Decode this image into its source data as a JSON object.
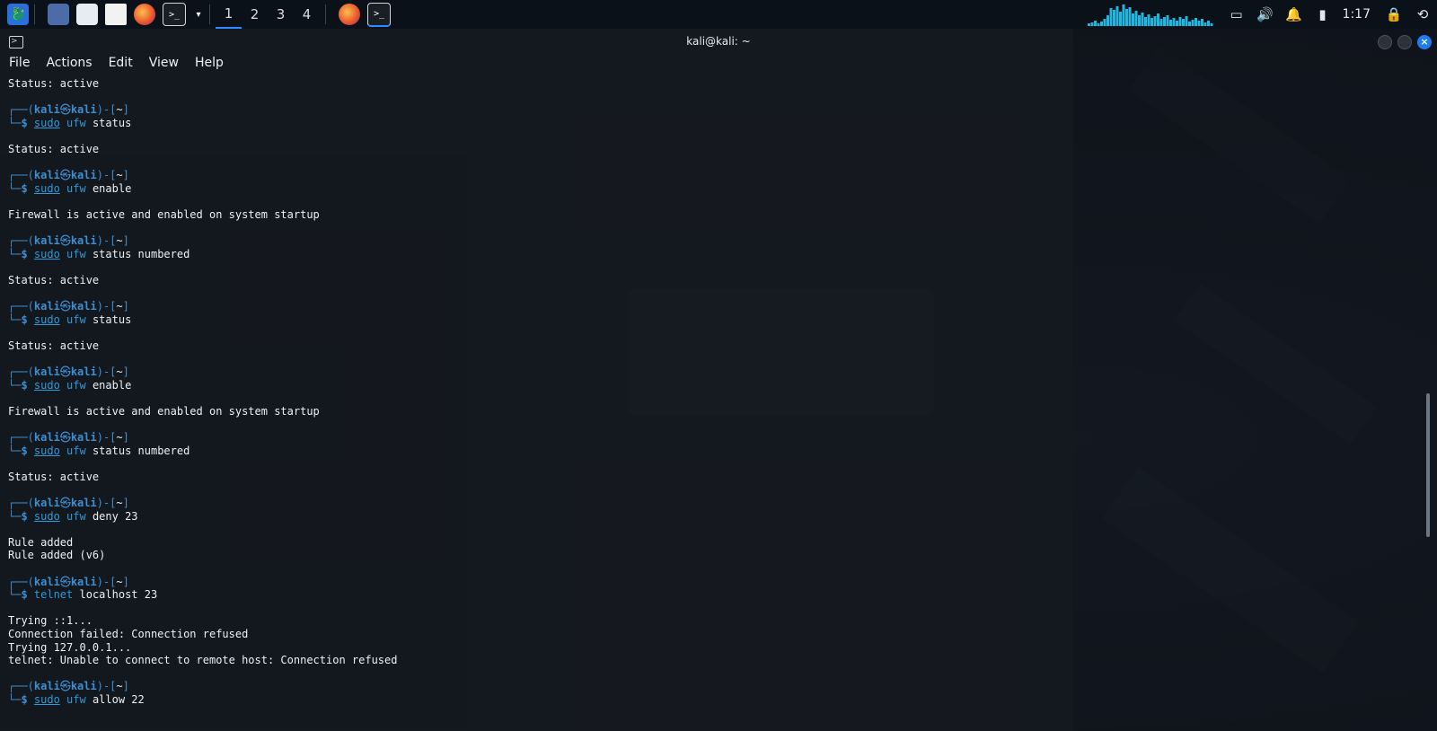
{
  "taskbar": {
    "workspaces": [
      "1",
      "2",
      "3",
      "4"
    ],
    "active_workspace": 1,
    "clock": "1:17",
    "accent": "#2b8cff",
    "icons": [
      "kali-menu-icon",
      "desktop-icon",
      "file-manager-icon",
      "text-editor-icon",
      "firefox-icon",
      "terminal-icon",
      "chevron-down-icon"
    ],
    "tray_icons": [
      "display-icon",
      "volume-icon",
      "bell-icon",
      "battery-icon",
      "lock-icon",
      "logout-icon"
    ]
  },
  "window": {
    "title": "kali@kali: ~",
    "menu": [
      "File",
      "Actions",
      "Edit",
      "View",
      "Help"
    ]
  },
  "prompt": {
    "open": "┌──(",
    "user": "kali",
    "at": "㉿",
    "host": "kali",
    "close": ")-[",
    "dir": "~",
    "end": "]",
    "cont": "└─",
    "dollar": "$ "
  },
  "terminal": [
    {
      "type": "out",
      "text": "Status: active"
    },
    {
      "type": "blank"
    },
    {
      "type": "cmd",
      "sudo": "sudo",
      "bin": "ufw",
      "args": " status"
    },
    {
      "type": "blank"
    },
    {
      "type": "out",
      "text": "Status: active"
    },
    {
      "type": "blank"
    },
    {
      "type": "cmd",
      "sudo": "sudo",
      "bin": "ufw",
      "args": " enable"
    },
    {
      "type": "blank"
    },
    {
      "type": "out",
      "text": "Firewall is active and enabled on system startup"
    },
    {
      "type": "blank"
    },
    {
      "type": "cmd",
      "sudo": "sudo",
      "bin": "ufw",
      "args": " status numbered"
    },
    {
      "type": "blank"
    },
    {
      "type": "out",
      "text": "Status: active"
    },
    {
      "type": "blank"
    },
    {
      "type": "cmd",
      "sudo": "sudo",
      "bin": "ufw",
      "args": " status"
    },
    {
      "type": "blank"
    },
    {
      "type": "out",
      "text": "Status: active"
    },
    {
      "type": "blank"
    },
    {
      "type": "cmd",
      "sudo": "sudo",
      "bin": "ufw",
      "args": " enable"
    },
    {
      "type": "blank"
    },
    {
      "type": "out",
      "text": "Firewall is active and enabled on system startup"
    },
    {
      "type": "blank"
    },
    {
      "type": "cmd",
      "sudo": "sudo",
      "bin": "ufw",
      "args": " status numbered"
    },
    {
      "type": "blank"
    },
    {
      "type": "out",
      "text": "Status: active"
    },
    {
      "type": "blank"
    },
    {
      "type": "cmd",
      "sudo": "sudo",
      "bin": "ufw",
      "args": " deny 23"
    },
    {
      "type": "blank"
    },
    {
      "type": "out",
      "text": "Rule added"
    },
    {
      "type": "out",
      "text": "Rule added (v6)"
    },
    {
      "type": "blank"
    },
    {
      "type": "cmd",
      "sudo": "",
      "bin": "telnet",
      "args": " localhost 23"
    },
    {
      "type": "blank"
    },
    {
      "type": "out",
      "text": "Trying ::1..."
    },
    {
      "type": "out",
      "text": "Connection failed: Connection refused"
    },
    {
      "type": "out",
      "text": "Trying 127.0.0.1..."
    },
    {
      "type": "out",
      "text": "telnet: Unable to connect to remote host: Connection refused"
    },
    {
      "type": "blank"
    },
    {
      "type": "cmd",
      "sudo": "sudo",
      "bin": "ufw",
      "args": " allow 22"
    }
  ]
}
